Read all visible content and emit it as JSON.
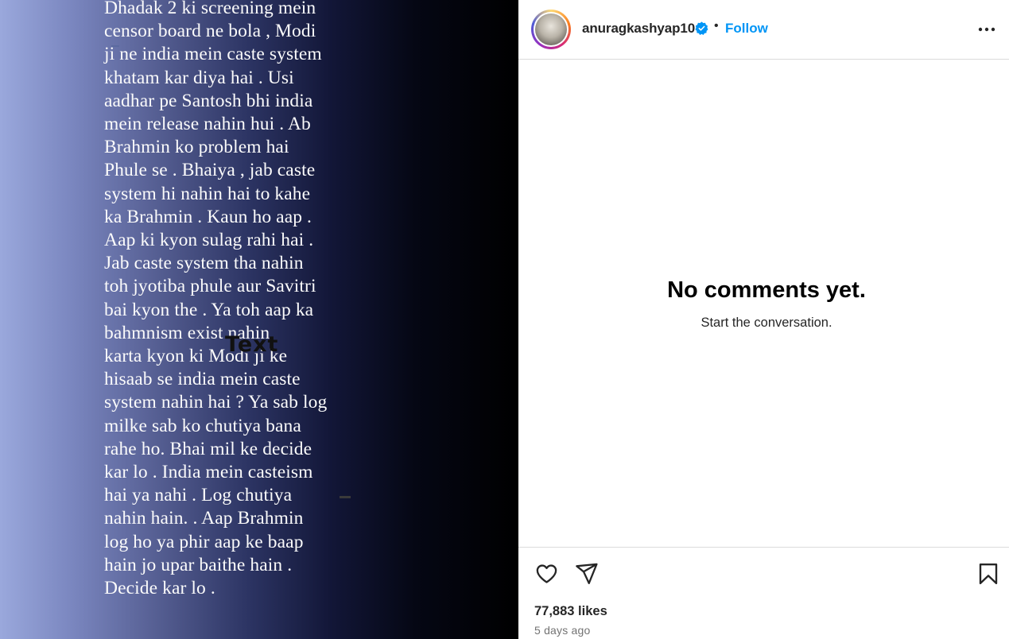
{
  "post": {
    "text": "Dhadak 2 ki screening mein\ncensor board ne bola , Modi\nji ne india mein caste system\nkhatam kar diya hai . Usi\naadhar pe Santosh bhi india\nmein release nahin hui . Ab\nBrahmin ko problem hai\nPhule se . Bhaiya , jab caste\nsystem hi nahin hai to kahe\nka Brahmin . Kaun ho aap .\nAap ki kyon sulag rahi hai .\nJab caste system tha nahin\ntoh jyotiba phule aur Savitri\nbai kyon the . Ya toh aap ka\nbahmnism exist nahin\nkarta kyon ki Modi ji ke\nhisaab se india mein caste\nsystem nahin hai ? Ya sab log\nmilke sab ko chutiya bana\nrahe ho. Bhai mil ke decide\nkar lo . India mein casteism\nhai ya nahi . Log chutiya\nnahin hain. . Aap Brahmin\nlog ho ya phir aap ke baap\nhain jo upar baithe hain .\nDecide kar lo .",
    "sticker_text": "Text"
  },
  "header": {
    "username": "anuragkashyap10",
    "separator": "•",
    "follow_label": "Follow"
  },
  "comments": {
    "empty_title": "No comments yet.",
    "empty_subtitle": "Start the conversation."
  },
  "actions": {
    "like_icon": "heart-icon",
    "share_icon": "paper-plane-icon",
    "save_icon": "bookmark-icon",
    "likes_text": "77,883 likes",
    "time_text": "5 days ago"
  },
  "colors": {
    "accent": "#0095f6",
    "verified": "#0095f6",
    "border": "#dbdbdb",
    "text_primary": "#262626",
    "text_secondary": "#737373"
  }
}
